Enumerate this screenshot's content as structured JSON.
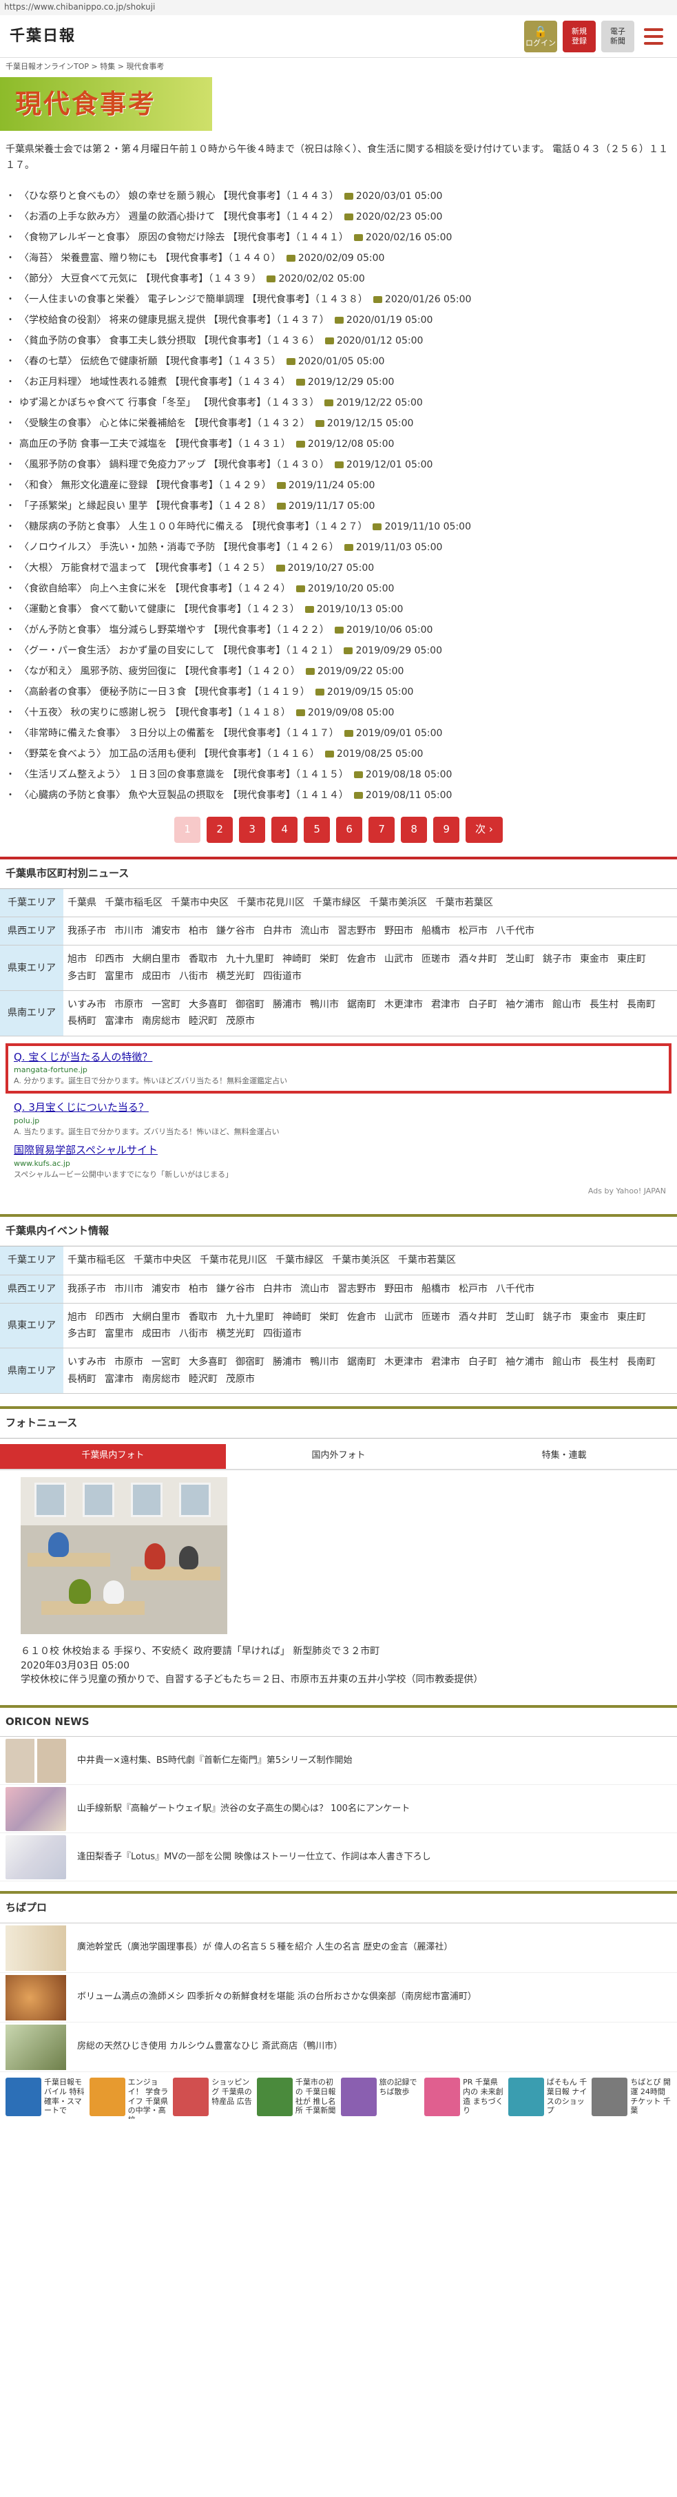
{
  "url": "https://www.chibanippo.co.jp/shokuji",
  "header": {
    "logo": "千葉日報",
    "login": "ログイン",
    "register_1": "新規",
    "register_2": "登録",
    "epaper_1": "電子",
    "epaper_2": "新聞"
  },
  "breadcrumb": "千葉日報オンラインTOP > 特集 > 現代食事考",
  "page_title": "現代食事考",
  "intro": "千葉県栄養士会では第２・第４月曜日午前１０時から午後４時まで（祝日は除く）、食生活に関する相談を受け付けています。 電話０４３（２５６）１１１７。",
  "articles": [
    {
      "title": "〈ひな祭りと食べもの〉 娘の幸せを願う親心 【現代食事考】（１４４３）",
      "date": "2020/03/01 05:00"
    },
    {
      "title": "〈お酒の上手な飲み方〉 週量の飲酒心掛けて 【現代食事考】（１４４２）",
      "date": "2020/02/23 05:00"
    },
    {
      "title": "〈食物アレルギーと食事〉 原因の食物だけ除去 【現代食事考】（１４４１）",
      "date": "2020/02/16 05:00"
    },
    {
      "title": "〈海苔〉 栄養豊富、贈り物にも 【現代食事考】（１４４０）",
      "date": "2020/02/09 05:00"
    },
    {
      "title": "〈節分〉 大豆食べて元気に 【現代食事考】（１４３９）",
      "date": "2020/02/02 05:00"
    },
    {
      "title": "〈一人住まいの食事と栄養〉 電子レンジで簡単調理 【現代食事考】（１４３８）",
      "date": "2020/01/26 05:00"
    },
    {
      "title": "〈学校給食の役割〉 将来の健康見据え提供 【現代食事考】（１４３７）",
      "date": "2020/01/19 05:00"
    },
    {
      "title": "〈貧血予防の食事〉 食事工夫し鉄分摂取 【現代食事考】（１４３６）",
      "date": "2020/01/12 05:00"
    },
    {
      "title": "〈春の七草〉 伝統色で健康祈願 【現代食事考】（１４３５）",
      "date": "2020/01/05 05:00"
    },
    {
      "title": "〈お正月料理〉 地域性表れる雑煮 【現代食事考】（１４３４）",
      "date": "2019/12/29 05:00"
    },
    {
      "title": "ゆず湯とかぼちゃ食べて 行事食「冬至」 【現代食事考】（１４３３）",
      "date": "2019/12/22 05:00"
    },
    {
      "title": "〈受験生の食事〉 心と体に栄養補給を 【現代食事考】（１４３２）",
      "date": "2019/12/15 05:00"
    },
    {
      "title": "高血圧の予防 食事一工夫で減塩を 【現代食事考】（１４３１）",
      "date": "2019/12/08 05:00"
    },
    {
      "title": "〈風邪予防の食事〉 鍋料理で免疫力アップ 【現代食事考】（１４３０）",
      "date": "2019/12/01 05:00"
    },
    {
      "title": "〈和食〉 無形文化遺産に登録 【現代食事考】（１４２９）",
      "date": "2019/11/24 05:00"
    },
    {
      "title": "「子孫繁栄」と縁起良い 里芋 【現代食事考】（１４２８）",
      "date": "2019/11/17 05:00"
    },
    {
      "title": "〈糖尿病の予防と食事〉 人生１００年時代に備える 【現代食事考】（１４２７）",
      "date": "2019/11/10 05:00"
    },
    {
      "title": "〈ノロウイルス〉 手洗い・加熱・消毒で予防 【現代食事考】（１４２６）",
      "date": "2019/11/03 05:00"
    },
    {
      "title": "〈大根〉 万能食材で温まって 【現代食事考】（１４２５）",
      "date": "2019/10/27 05:00"
    },
    {
      "title": "〈食欲自給率〉 向上へ主食に米を 【現代食事考】（１４２４）",
      "date": "2019/10/20 05:00"
    },
    {
      "title": "〈運動と食事〉 食べて動いて健康に 【現代食事考】（１４２３）",
      "date": "2019/10/13 05:00"
    },
    {
      "title": "〈がん予防と食事〉 塩分減らし野菜増やす 【現代食事考】（１４２２）",
      "date": "2019/10/06 05:00"
    },
    {
      "title": "〈グー・パー食生活〉 おかず量の目安にして 【現代食事考】（１４２１）",
      "date": "2019/09/29 05:00"
    },
    {
      "title": "〈なが和え〉 風邪予防、疲労回復に 【現代食事考】（１４２０）",
      "date": "2019/09/22 05:00"
    },
    {
      "title": "〈高齢者の食事〉 便秘予防に一日３食 【現代食事考】（１４１９）",
      "date": "2019/09/15 05:00"
    },
    {
      "title": "〈十五夜〉 秋の実りに感謝し祝う 【現代食事考】（１４１８）",
      "date": "2019/09/08 05:00"
    },
    {
      "title": "〈非常時に備えた食事〉 ３日分以上の備蓄を 【現代食事考】（１４１７）",
      "date": "2019/09/01 05:00"
    },
    {
      "title": "〈野菜を食べよう〉 加工品の活用も便利 【現代食事考】（１４１６）",
      "date": "2019/08/25 05:00"
    },
    {
      "title": "〈生活リズム整えよう〉 １日３回の食事意識を 【現代食事考】（１４１５）",
      "date": "2019/08/18 05:00"
    },
    {
      "title": "〈心臓病の予防と食事〉 魚や大豆製品の摂取を 【現代食事考】（１４１４）",
      "date": "2019/08/11 05:00"
    }
  ],
  "pagination": {
    "pages": [
      "1",
      "2",
      "3",
      "4",
      "5",
      "6",
      "7",
      "8",
      "9"
    ],
    "current": "1",
    "next": "次 ›"
  },
  "city_news": {
    "heading": "千葉県市区町村別ニュース",
    "rows": [
      {
        "area": "千葉エリア",
        "towns": [
          "千葉県",
          "千葉市稲毛区",
          "千葉市中央区",
          "千葉市花見川区",
          "千葉市緑区",
          "千葉市美浜区",
          "千葉市若葉区"
        ]
      },
      {
        "area": "県西エリア",
        "towns": [
          "我孫子市",
          "市川市",
          "浦安市",
          "柏市",
          "鎌ケ谷市",
          "白井市",
          "流山市",
          "習志野市",
          "野田市",
          "船橋市",
          "松戸市",
          "八千代市"
        ]
      },
      {
        "area": "県東エリア",
        "towns": [
          "旭市",
          "印西市",
          "大網白里市",
          "香取市",
          "九十九里町",
          "神崎町",
          "栄町",
          "佐倉市",
          "山武市",
          "匝瑳市",
          "酒々井町",
          "芝山町",
          "銚子市",
          "東金市",
          "東庄町",
          "多古町",
          "富里市",
          "成田市",
          "八街市",
          "横芝光町",
          "四街道市"
        ]
      },
      {
        "area": "県南エリア",
        "towns": [
          "いすみ市",
          "市原市",
          "一宮町",
          "大多喜町",
          "御宿町",
          "勝浦市",
          "鴨川市",
          "鋸南町",
          "木更津市",
          "君津市",
          "白子町",
          "袖ケ浦市",
          "館山市",
          "長生村",
          "長南町",
          "長柄町",
          "富津市",
          "南房総市",
          "睦沢町",
          "茂原市"
        ]
      }
    ]
  },
  "ads": {
    "ad1_title": "Q. 宝くじが当たる人の特徴？",
    "ad1_url": "mangata-fortune.jp",
    "ad1_desc": "A. 分かります。誕生日で分かります。怖いほどズバリ当たる！無料金運鑑定占い",
    "ad2_title": "Q. 3月宝くじについた当る？",
    "ad2_url": "polu.jp",
    "ad2_desc": "A. 当たります。誕生日で分かります。ズバリ当たる！怖いほど、無料金運占い",
    "ad3_title": "国際貿易学部スペシャルサイト",
    "ad3_url": "www.kufs.ac.jp",
    "ad3_desc": "スペシャルムービー公開中いますでになり「新しいがはじまる」",
    "footer": "Ads by Yahoo! JAPAN"
  },
  "events": {
    "heading": "千葉県内イベント情報",
    "rows": [
      {
        "area": "千葉エリア",
        "towns": [
          "千葉市稲毛区",
          "千葉市中央区",
          "千葉市花見川区",
          "千葉市緑区",
          "千葉市美浜区",
          "千葉市若葉区"
        ]
      },
      {
        "area": "県西エリア",
        "towns": [
          "我孫子市",
          "市川市",
          "浦安市",
          "柏市",
          "鎌ケ谷市",
          "白井市",
          "流山市",
          "習志野市",
          "野田市",
          "船橋市",
          "松戸市",
          "八千代市"
        ]
      },
      {
        "area": "県東エリア",
        "towns": [
          "旭市",
          "印西市",
          "大網白里市",
          "香取市",
          "九十九里町",
          "神崎町",
          "栄町",
          "佐倉市",
          "山武市",
          "匝瑳市",
          "酒々井町",
          "芝山町",
          "銚子市",
          "東金市",
          "東庄町",
          "多古町",
          "富里市",
          "成田市",
          "八街市",
          "横芝光町",
          "四街道市"
        ]
      },
      {
        "area": "県南エリア",
        "towns": [
          "いすみ市",
          "市原市",
          "一宮町",
          "大多喜町",
          "御宿町",
          "勝浦市",
          "鴨川市",
          "鋸南町",
          "木更津市",
          "君津市",
          "白子町",
          "袖ケ浦市",
          "館山市",
          "長生村",
          "長南町",
          "長柄町",
          "富津市",
          "南房総市",
          "睦沢町",
          "茂原市"
        ]
      }
    ]
  },
  "photo_news": {
    "heading": "フォトニュース",
    "tabs": [
      "千葉県内フォト",
      "国内外フォト",
      "特集・連載"
    ],
    "caption": "６１０校 休校始まる 手探り、不安続く 政府要請「早ければ」 新型肺炎で３２市町",
    "date": "2020年03月03日 05:00",
    "desc": "学校休校に伴う児童の預かりで、自習する子どもたち＝２日、市原市五井東の五井小学校（同市教委提供）"
  },
  "oricon": {
    "heading": "ORICON NEWS",
    "items": [
      "中井貴一×遠村集、BS時代劇『首斬仁左衛門』第5シリーズ制作開始",
      "山手線新駅『高輪ゲートウェイ駅』渋谷の女子高生の関心は？ 100名にアンケート",
      "逢田梨香子『Lotus』MVの一部を公開 映像はストーリー仕立て、作詞は本人書き下ろし"
    ]
  },
  "chiba_pro": {
    "heading": "ちばプロ",
    "items": [
      "廣池幹堂氏（廣池学園理事長）が 偉人の名言５５種を紹介 人生の名言 歴史の金言（麗澤社）",
      "ボリューム満点の漁師メシ 四季折々の新鮮食材を堪能 浜の台所おさかな倶楽部（南房総市富浦町）",
      "房総の天然ひじき使用 カルシウム豊富なひじ 斎武商店（鴨川市）"
    ]
  },
  "banners": [
    "千葉日報モバイル 特科確率・スマートで",
    "エンジョイ！ 学食ライフ 千葉県の中学・高校",
    "ショッピング 千葉県の特産品 広告",
    "千葉市の初の 千葉日報社が 推し名所 千葉新聞",
    "旅の記録で ちば散歩",
    "PR 千葉県内の 未来創造 まちづくり",
    "ぱそもん 千葉日報 ナイスのショップ",
    "ちばとぴ 開運 24時間チケット 千葉"
  ]
}
